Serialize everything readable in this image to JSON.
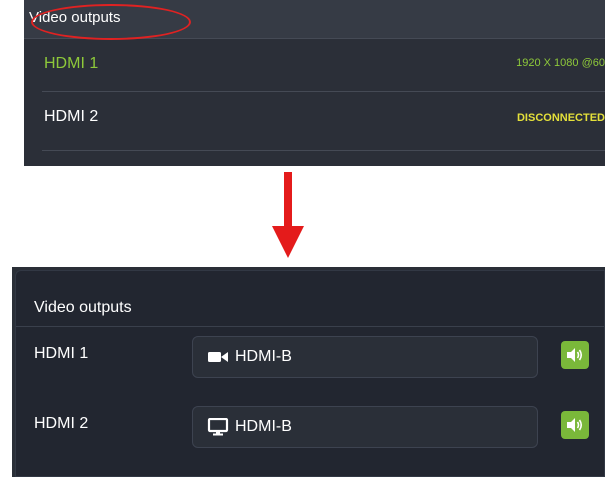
{
  "old_panel": {
    "title": "Video outputs",
    "rows": [
      {
        "name": "HDMI 1",
        "status": "1920 X 1080 @60",
        "status_color": "#8ec93a"
      },
      {
        "name": "HDMI 2",
        "status": "DISCONNECTED",
        "status_color": "#e4e03a"
      }
    ]
  },
  "arrow": {
    "icon": "arrow-down-icon",
    "color": "#e41b1b"
  },
  "highlight": {
    "shape": "ellipse",
    "color": "#e02222"
  },
  "new_panel": {
    "title": "Video outputs",
    "rows": [
      {
        "name": "HDMI 1",
        "source_icon": "camera-icon",
        "source": "HDMI-B",
        "audio_icon": "speaker-icon"
      },
      {
        "name": "HDMI 2",
        "source_icon": "monitor-icon",
        "source": "HDMI-B",
        "audio_icon": "speaker-icon"
      }
    ],
    "accent_color": "#7ab83a"
  }
}
